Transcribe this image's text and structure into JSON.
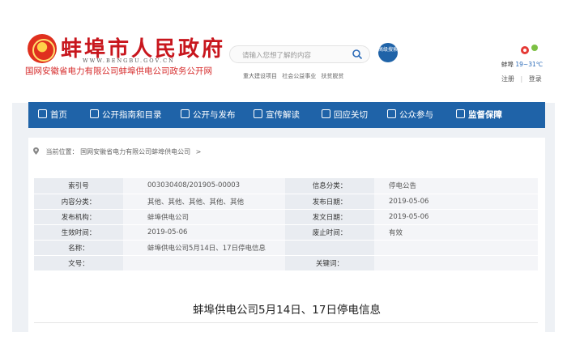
{
  "header": {
    "top_link": "",
    "site_title": "蚌埠市人民政府",
    "site_domain": "WWW.BENGBU.GOV.CN",
    "company_line": "国网安徽省电力有限公司蚌埠供电公司政务公开网",
    "search_placeholder": "请输入您想了解的内容",
    "advanced_search": "高级搜索",
    "hot_links": [
      "重大建设项目",
      "社会公益事业",
      "扶贫脱贫"
    ],
    "weather_city": "蚌埠",
    "weather_temp": "19~31℃",
    "register": "注册",
    "login": "登录"
  },
  "nav": {
    "items": [
      "首页",
      "公开指南和目录",
      "公开与发布",
      "宣传解读",
      "回应关切",
      "公众参与",
      "监督保障"
    ]
  },
  "breadcrumb": {
    "label": "当前位置：",
    "path": "国网安徽省电力有限公司蚌埠供电公司",
    "separator": ">"
  },
  "info": {
    "rows": [
      {
        "k1": "索引号",
        "v1": "003030408/201905-00003",
        "k2": "信息分类：",
        "v2": "停电公告"
      },
      {
        "k1": "内容分类：",
        "v1": "其他、其他、其他、其他、其他",
        "k2": "发布日期：",
        "v2": "2019-05-06"
      },
      {
        "k1": "发布机构：",
        "v1": "蚌埠供电公司",
        "k2": "发文日期：",
        "v2": "2019-05-06"
      },
      {
        "k1": "生效时间：",
        "v1": "2019-05-06",
        "k2": "废止时间：",
        "v2": "有效"
      },
      {
        "k1": "名称：",
        "v1": "蚌埠供电公司5月14日、17日停电信息",
        "k2": "",
        "v2": ""
      },
      {
        "k1": "文号：",
        "v1": "",
        "k2": "关键词：",
        "v2": ""
      }
    ]
  },
  "article": {
    "title": "蚌埠供电公司5月14日、17日停电信息"
  },
  "colors": {
    "brand_red": "#c8161d",
    "nav_blue": "#1f63a8"
  },
  "icons": [
    "emblem-icon",
    "search-icon",
    "weather-icon",
    "location-pin-icon",
    "home-icon",
    "document-icon"
  ]
}
